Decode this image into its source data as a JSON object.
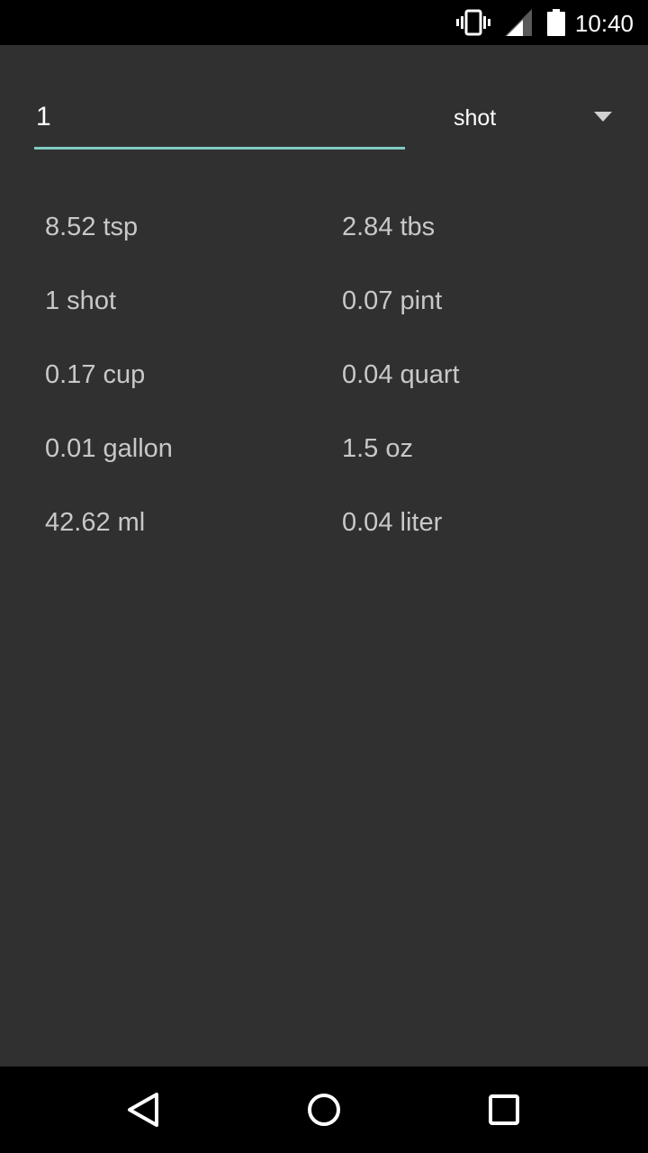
{
  "status_bar": {
    "time": "10:40",
    "icons": [
      "vibrate-icon",
      "cell-signal-icon",
      "battery-icon"
    ]
  },
  "converter": {
    "input_value": "1",
    "selected_unit": "shot",
    "accent_color": "#80cbc4"
  },
  "results": [
    {
      "left": "8.52 tsp",
      "right": "2.84 tbs"
    },
    {
      "left": "1 shot",
      "right": "0.07 pint"
    },
    {
      "left": "0.17 cup",
      "right": "0.04 quart"
    },
    {
      "left": "0.01 gallon",
      "right": "1.5 oz"
    },
    {
      "left": "42.62 ml",
      "right": "0.04 liter"
    }
  ],
  "nav_bar": {
    "buttons": [
      "back-icon",
      "home-icon",
      "recents-icon"
    ]
  }
}
